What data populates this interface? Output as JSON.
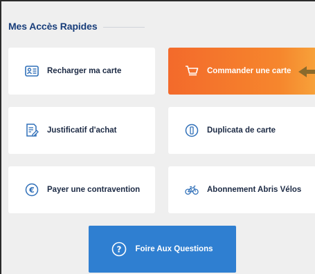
{
  "section": {
    "title": "Mes Accès Rapides"
  },
  "tiles": [
    {
      "label": "Recharger ma carte",
      "icon": "id-card-icon"
    },
    {
      "label": "Commander une carte",
      "icon": "cart-icon",
      "highlight": "#f36a2b"
    },
    {
      "label": "Justificatif d'achat",
      "icon": "receipt-edit-icon"
    },
    {
      "label": "Duplicata de carte",
      "icon": "card-circle-icon"
    },
    {
      "label": "Payer une contravention",
      "icon": "euro-circle-icon"
    },
    {
      "label": "Abonnement Abris Vélos",
      "icon": "bicycle-icon"
    }
  ],
  "faq": {
    "label": "Foire Aux Questions",
    "icon": "question-circle-icon",
    "color": "#2f7fd1"
  },
  "colors": {
    "title": "#183d7a",
    "icon": "#2f6fb8",
    "accent_orange": "#f36a2b"
  }
}
